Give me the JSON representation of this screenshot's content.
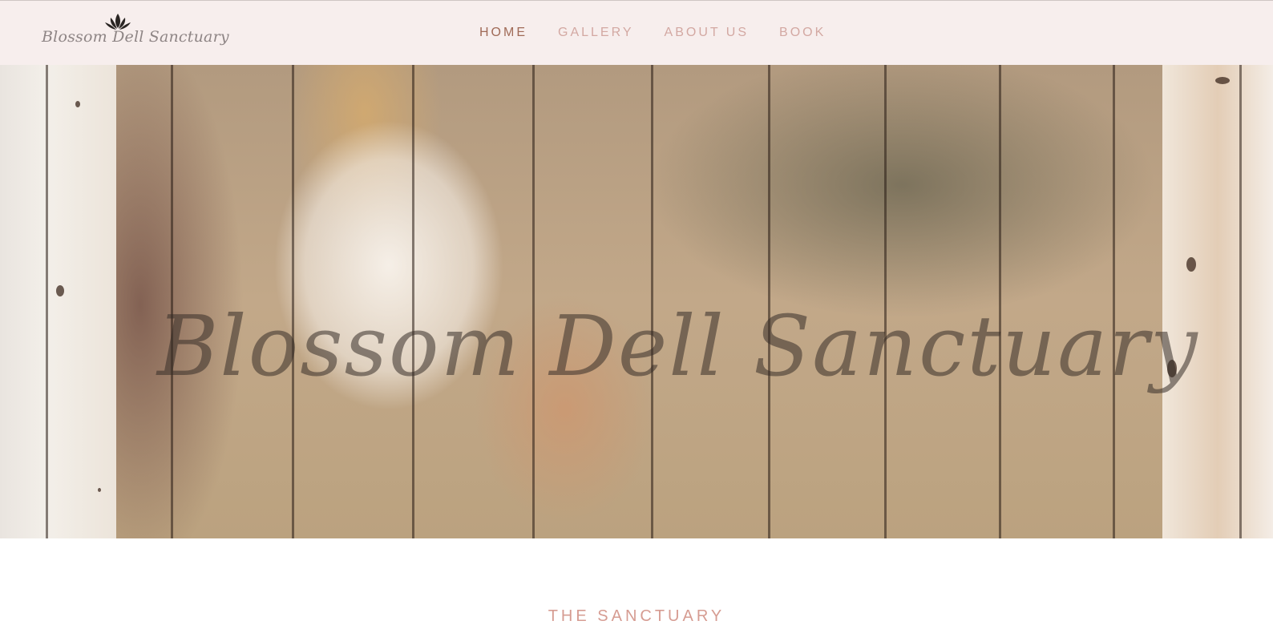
{
  "brand": {
    "logo_text": "Blossom Dell Sanctuary",
    "logo_icon": "lotus-icon",
    "logo_color": "#8e8585"
  },
  "nav": {
    "items": [
      {
        "label": "HOME",
        "active": true
      },
      {
        "label": "GALLERY",
        "active": false
      },
      {
        "label": "ABOUT US",
        "active": false
      },
      {
        "label": "BOOK",
        "active": false
      }
    ],
    "active_color": "#a06a57",
    "inactive_color": "#d3a8a2"
  },
  "hero": {
    "title": "Blossom Dell Sanctuary"
  },
  "section": {
    "title": "THE SANCTUARY"
  },
  "colors": {
    "header_bg": "#f7eeed",
    "accent": "#d69c92"
  }
}
